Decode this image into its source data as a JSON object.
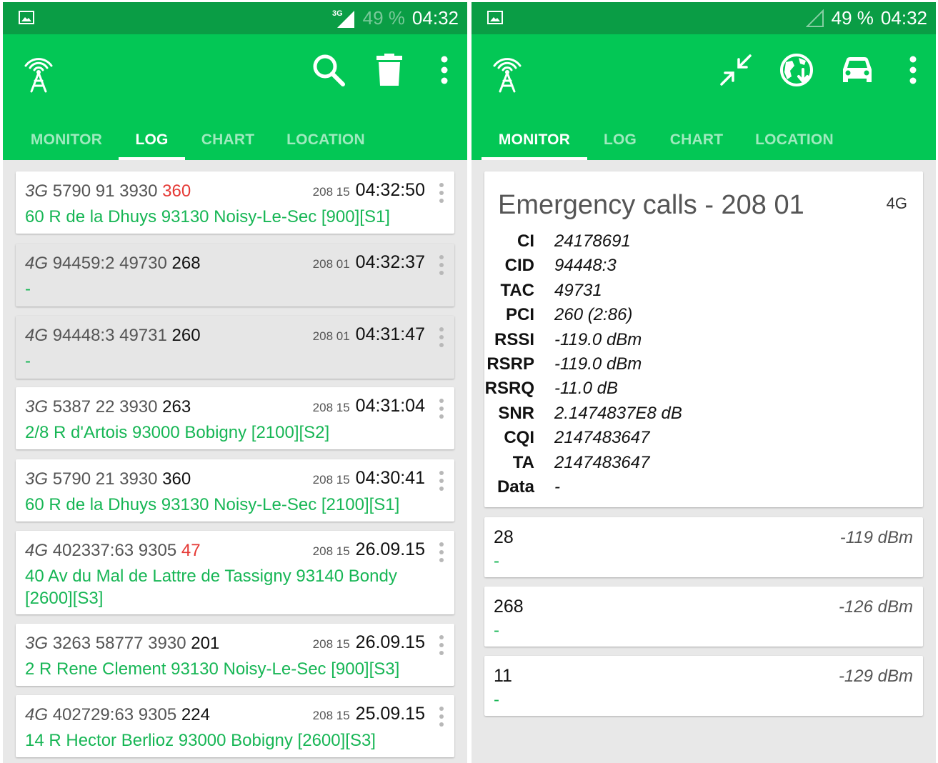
{
  "status_left": {
    "network": "3G",
    "battery": "49 %",
    "time": "04:32"
  },
  "status_right": {
    "battery": "49 %",
    "time": "04:32"
  },
  "tabs": [
    "MONITOR",
    "LOG",
    "CHART",
    "LOCATION"
  ],
  "left_active_tab": "LOG",
  "right_active_tab": "MONITOR",
  "left_actions": [
    "search-icon",
    "trash-icon",
    "overflow-menu-icon"
  ],
  "right_actions": [
    "compress-arrows-icon",
    "globe-download-icon",
    "car-icon",
    "overflow-menu-icon"
  ],
  "log": [
    {
      "tech": "3G",
      "ids": "5790 91 3930",
      "code": "360",
      "code_red": true,
      "net": "208 15",
      "time": "04:32:50",
      "addr": "60 R de la Dhuys 93130 Noisy-Le-Sec [900][S1]",
      "grey": false
    },
    {
      "tech": "4G",
      "ids": "94459:2 49730",
      "code": "268",
      "code_red": false,
      "net": "208 01",
      "time": "04:32:37",
      "addr": "-",
      "grey": true
    },
    {
      "tech": "4G",
      "ids": "94448:3 49731",
      "code": "260",
      "code_red": false,
      "net": "208 01",
      "time": "04:31:47",
      "addr": "-",
      "grey": true
    },
    {
      "tech": "3G",
      "ids": "5387 22 3930",
      "code": "263",
      "code_red": false,
      "net": "208 15",
      "time": "04:31:04",
      "addr": "2/8 R d'Artois 93000 Bobigny [2100][S2]",
      "grey": false
    },
    {
      "tech": "3G",
      "ids": "5790 21 3930",
      "code": "360",
      "code_red": false,
      "net": "208 15",
      "time": "04:30:41",
      "addr": "60 R de la Dhuys 93130 Noisy-Le-Sec [2100][S1]",
      "grey": false
    },
    {
      "tech": "4G",
      "ids": "402337:63 9305",
      "code": "47",
      "code_red": true,
      "net": "208 15",
      "time": "26.09.15",
      "addr": "40 Av du Mal de Lattre de Tassigny 93140 Bondy [2600][S3]",
      "grey": false
    },
    {
      "tech": "3G",
      "ids": "3263 58777 3930",
      "code": "201",
      "code_red": false,
      "net": "208 15",
      "time": "26.09.15",
      "addr": "2 R Rene Clement 93130 Noisy-Le-Sec [900][S3]",
      "grey": false
    },
    {
      "tech": "4G",
      "ids": "402729:63 9305",
      "code": "224",
      "code_red": false,
      "net": "208 15",
      "time": "25.09.15",
      "addr": "14 R Hector Berlioz 93000 Bobigny [2600][S3]",
      "grey": false
    }
  ],
  "monitor": {
    "title": "Emergency calls - 208 01",
    "tech": "4G",
    "fields": [
      {
        "k": "CI",
        "v": "24178691"
      },
      {
        "k": "CID",
        "v": "94448:3"
      },
      {
        "k": "TAC",
        "v": "49731"
      },
      {
        "k": "PCI",
        "v": "260 (2:86)"
      },
      {
        "k": "RSSI",
        "v": "-119.0 dBm"
      },
      {
        "k": "RSRP",
        "v": "-119.0 dBm"
      },
      {
        "k": "RSRQ",
        "v": "-11.0 dB"
      },
      {
        "k": "SNR",
        "v": "2.1474837E8 dB"
      },
      {
        "k": "CQI",
        "v": "2147483647"
      },
      {
        "k": "TA",
        "v": "2147483647"
      },
      {
        "k": "Data",
        "v": "-"
      }
    ],
    "neighbors": [
      {
        "cell": "28",
        "dbm": "-119 dBm",
        "sub": "-"
      },
      {
        "cell": "268",
        "dbm": "-126 dBm",
        "sub": "-"
      },
      {
        "cell": "11",
        "dbm": "-129 dBm",
        "sub": "-"
      }
    ]
  },
  "colors": {
    "statusbar": "#0a9d45",
    "appbar": "#03c755",
    "accent_text": "#17b655",
    "alert": "#e53935"
  }
}
